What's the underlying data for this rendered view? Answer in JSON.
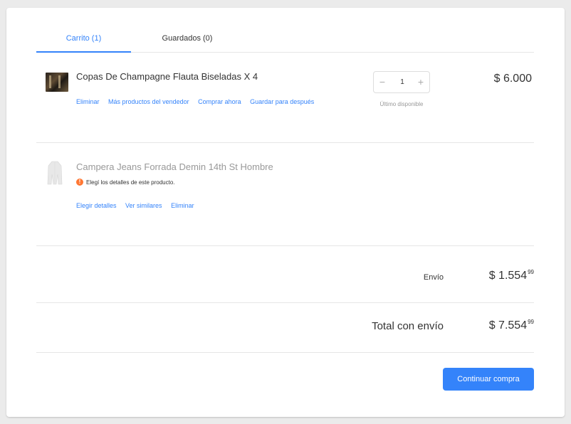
{
  "tabs": {
    "cart": "Carrito (1)",
    "saved": "Guardados (0)"
  },
  "items": [
    {
      "title": "Copas De Champagne Flauta Biseladas X 4",
      "actions": [
        "Eliminar",
        "Más productos del vendedor",
        "Comprar ahora",
        "Guardar para después"
      ],
      "quantity": "1",
      "quantity_note": "Último disponible",
      "price": "$ 6.000"
    },
    {
      "title": "Campera Jeans Forrada Demin 14th St Hombre",
      "warning": "Elegí los detalles de este producto.",
      "actions": [
        "Elegir detalles",
        "Ver similares",
        "Eliminar"
      ]
    }
  ],
  "summary": {
    "shipping_label": "Envío",
    "shipping_amount": "$ 1.554",
    "shipping_cents": "99",
    "total_label": "Total con envío",
    "total_amount": "$ 7.554",
    "total_cents": "99"
  },
  "cta": "Continuar compra",
  "colors": {
    "accent": "#3483fa",
    "warning": "#ff7733",
    "background": "#ebebeb"
  }
}
